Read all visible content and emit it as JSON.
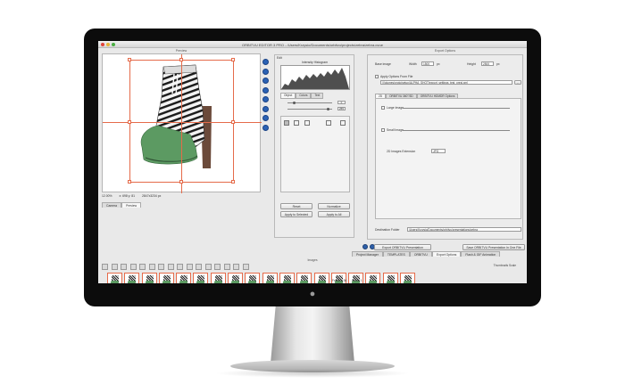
{
  "window": {
    "title": "ORBITVU EDITOR 3 PRO - /Users/Krzysio/Documents/orbitvu/projects/zebra/zebra.ovue"
  },
  "preview": {
    "title": "Preview",
    "status_zoom": "12.00%",
    "status_coords": "x: 698 y: 81",
    "status_size": "2847x3234 px"
  },
  "views_tabs": [
    {
      "label": "Camera",
      "active": false
    },
    {
      "label": "Preview",
      "active": true
    }
  ],
  "edit": {
    "section_label": "Edit",
    "histogram_title": "Intensity Histogram",
    "tabs": [
      {
        "label": "Object",
        "active": true
      },
      {
        "label": "Colors",
        "active": false
      },
      {
        "label": "Text",
        "active": false
      }
    ],
    "slider_values": [
      "0",
      "255"
    ],
    "buttons": {
      "reset": "Reset",
      "normalize": "Normalize",
      "apply_selected": "Apply to Selected",
      "apply_all": "Apply to All"
    }
  },
  "export": {
    "title": "Export Options",
    "base_image_label": "Base image",
    "width_label": "Width",
    "width_value": "1500",
    "width_unit": "px",
    "height_label": "Height",
    "height_value": "2500",
    "height_unit": "px",
    "apply_from_file_label": "Apply Options From File",
    "apply_from_file_path": "/Volumes/proto/setup/ALPHA_SHOT/export_settings_test_presi.xml",
    "browse_label": "...",
    "tabs": [
      {
        "label": "2D",
        "active": true
      },
      {
        "label": "ORBITVU 360°/3D",
        "active": false
      },
      {
        "label": "ORBITVU HDMDR Options",
        "active": false
      }
    ],
    "large_image_label": "Large Image",
    "small_image_label": "Small Image",
    "extension_label": "2D Images Extension",
    "extension_value": "JPG",
    "destination_label": "Destination Folder",
    "destination_path": "/Users/Krzysio/Documents/orbitvu/presentations/zebra",
    "export_button": "Export ORBITVU Presentation",
    "save_one_file_button": "Save ORBITVU Presentation In One File"
  },
  "lower_tabs": [
    {
      "label": "Project Manager",
      "active": false
    },
    {
      "label": "TEMPLATES",
      "active": false
    },
    {
      "label": "ORBITVU",
      "active": false
    },
    {
      "label": "Export Options",
      "active": true
    },
    {
      "label": "Flash & GIF Animation",
      "active": false
    }
  ],
  "images": {
    "title": "Images",
    "scale_label": "Thumbnails Scale",
    "numbers": [
      "18",
      "19",
      "20",
      "21",
      "22",
      "23",
      "24",
      "25",
      "26",
      "27",
      "28",
      "29",
      "30",
      "31",
      "32",
      "33",
      "34",
      "35"
    ]
  },
  "footer": {
    "frames": "Frames: 36",
    "rows": "Rows: 1"
  },
  "colors": {
    "accent_blue": "#2b62b5",
    "guide_orange": "#e56b4a",
    "toe_green": "#5c9a62"
  },
  "icons": [
    "zoom-in-icon",
    "zoom-out-icon",
    "rotate-icon",
    "crop-icon",
    "select-icon",
    "play-icon",
    "prev-icon",
    "next-icon"
  ]
}
